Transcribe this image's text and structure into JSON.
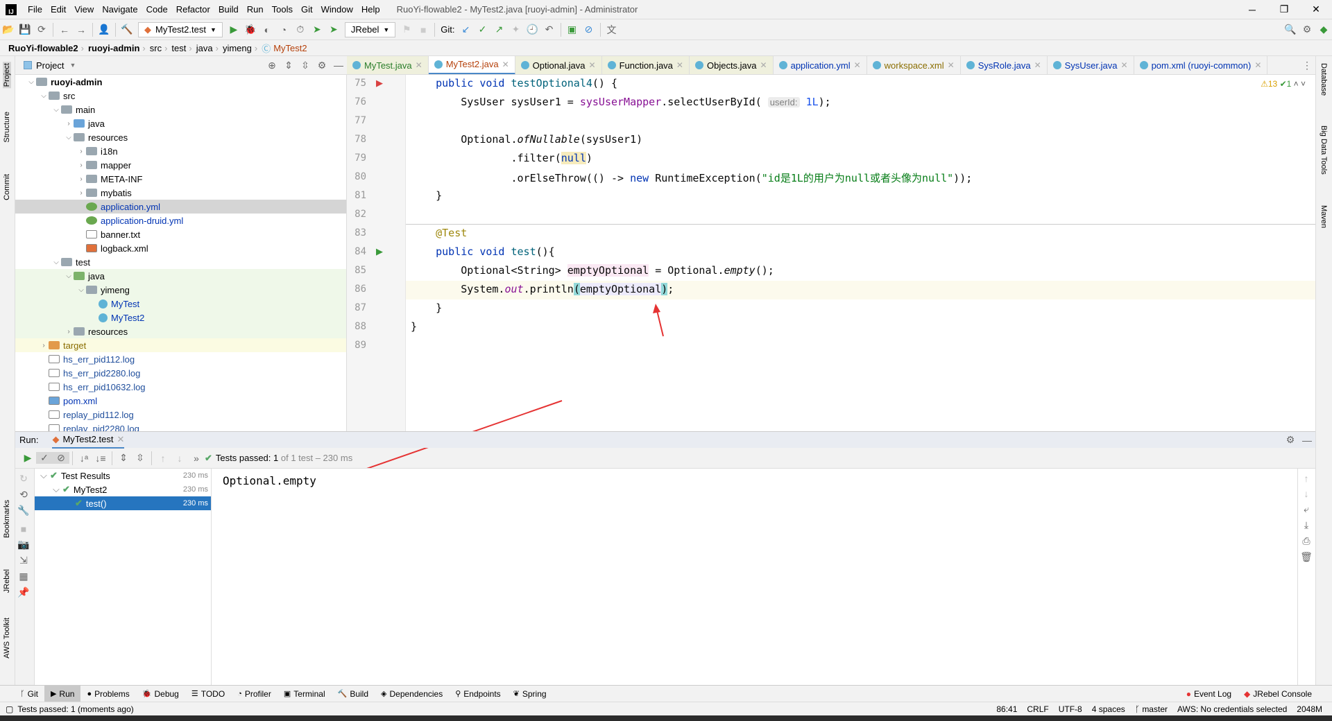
{
  "app": {
    "logo": "IJ",
    "menu": [
      "File",
      "Edit",
      "View",
      "Navigate",
      "Code",
      "Refactor",
      "Build",
      "Run",
      "Tools",
      "Git",
      "Window",
      "Help"
    ],
    "title": "RuoYi-flowable2 - MyTest2.java [ruoyi-admin] - Administrator",
    "window_controls": [
      "─",
      "❐",
      "✕"
    ]
  },
  "toolbar": {
    "run_config": "MyTest2.test",
    "jrebel": "JRebel",
    "git_label": "Git:"
  },
  "breadcrumb": [
    "RuoYi-flowable2",
    "ruoyi-admin",
    "src",
    "test",
    "java",
    "yimeng",
    "MyTest2"
  ],
  "left_stripe": [
    "Project",
    "Structure",
    "Commit",
    "Bookmarks",
    "JRebel",
    "AWS Toolkit"
  ],
  "right_stripe": [
    "Database",
    "Big Data Tools",
    "Maven"
  ],
  "project": {
    "title": "Project",
    "tree": [
      {
        "label": "ruoyi-admin",
        "level": 0,
        "arrow": "v",
        "icon": "folder",
        "bold": true
      },
      {
        "label": "src",
        "level": 1,
        "arrow": "v",
        "icon": "folder"
      },
      {
        "label": "main",
        "level": 2,
        "arrow": "v",
        "icon": "folder"
      },
      {
        "label": "java",
        "level": 3,
        "arrow": ">",
        "icon": "folder-blue"
      },
      {
        "label": "resources",
        "level": 3,
        "arrow": "v",
        "icon": "folder"
      },
      {
        "label": "i18n",
        "level": 4,
        "arrow": ">",
        "icon": "folder"
      },
      {
        "label": "mapper",
        "level": 4,
        "arrow": ">",
        "icon": "folder"
      },
      {
        "label": "META-INF",
        "level": 4,
        "arrow": ">",
        "icon": "folder"
      },
      {
        "label": "mybatis",
        "level": 4,
        "arrow": ">",
        "icon": "folder"
      },
      {
        "label": "application.yml",
        "level": 4,
        "icon": "yml",
        "color": "#0033b3",
        "selected": true
      },
      {
        "label": "application-druid.yml",
        "level": 4,
        "icon": "yml",
        "color": "#0033b3"
      },
      {
        "label": "banner.txt",
        "level": 4,
        "icon": "file"
      },
      {
        "label": "logback.xml",
        "level": 4,
        "icon": "xml"
      },
      {
        "label": "test",
        "level": 2,
        "arrow": "v",
        "icon": "folder"
      },
      {
        "label": "java",
        "level": 3,
        "arrow": "v",
        "icon": "folder-green",
        "green": true
      },
      {
        "label": "yimeng",
        "level": 4,
        "arrow": "v",
        "icon": "folder",
        "green": true
      },
      {
        "label": "MyTest",
        "level": 5,
        "icon": "java",
        "color": "#0033b3",
        "green": true
      },
      {
        "label": "MyTest2",
        "level": 5,
        "icon": "java",
        "color": "#0033b3",
        "green": true
      },
      {
        "label": "resources",
        "level": 3,
        "arrow": ">",
        "icon": "folder",
        "green": true
      },
      {
        "label": "target",
        "level": 1,
        "arrow": ">",
        "icon": "folder-orange",
        "yellow": true,
        "color": "#8a6d00"
      },
      {
        "label": "hs_err_pid112.log",
        "level": 1,
        "icon": "file",
        "color": "#1f4e9c"
      },
      {
        "label": "hs_err_pid2280.log",
        "level": 1,
        "icon": "file",
        "color": "#1f4e9c"
      },
      {
        "label": "hs_err_pid10632.log",
        "level": 1,
        "icon": "file",
        "color": "#1f4e9c"
      },
      {
        "label": "pom.xml",
        "level": 1,
        "icon": "maven",
        "color": "#0033b3"
      },
      {
        "label": "replay_pid112.log",
        "level": 1,
        "icon": "file",
        "color": "#1f4e9c"
      },
      {
        "label": "replay_pid2280.log",
        "level": 1,
        "icon": "file",
        "color": "#1f4e9c"
      }
    ]
  },
  "tabs": [
    {
      "label": "MyTest.java",
      "color": "#2a7d2a"
    },
    {
      "label": "MyTest2.java",
      "color": "#b5400a",
      "active": true
    },
    {
      "label": "Optional.java",
      "color": "#000"
    },
    {
      "label": "Function.java",
      "color": "#000"
    },
    {
      "label": "Objects.java",
      "color": "#000"
    },
    {
      "label": "application.yml",
      "color": "#0033b3"
    },
    {
      "label": "workspace.xml",
      "color": "#8a6d00"
    },
    {
      "label": "SysRole.java",
      "color": "#0033b3"
    },
    {
      "label": "SysUser.java",
      "color": "#0033b3"
    },
    {
      "label": "pom.xml (ruoyi-common)",
      "color": "#0033b3"
    }
  ],
  "editor": {
    "warnings": "⚠13",
    "ok": "✔1",
    "lines": [
      {
        "n": "75",
        "html": "    <span class='kw'>public void</span> <span class='fn'>testOptional4</span>() {"
      },
      {
        "n": "76",
        "html": "        SysUser sysUser1 = <span class='fld'>sysUserMapper</span>.selectUserById( <span class='hint'>userId:</span> <span class='num'>1L</span>);"
      },
      {
        "n": "77",
        "html": ""
      },
      {
        "n": "78",
        "html": "        Optional.<span class='it'>ofNullable</span>(sysUser1)"
      },
      {
        "n": "79",
        "html": "                .filter(<span class='kw' style='background:#f6ebbc'>null</span>)"
      },
      {
        "n": "80",
        "html": "                .orElseThrow(() -> <span class='kw'>new</span> RuntimeException(<span class='str'>\"id是1L的用户为null或者头像为null\"</span>));"
      },
      {
        "n": "81",
        "html": "    }"
      },
      {
        "n": "82",
        "html": ""
      },
      {
        "n": "83",
        "html": "    <span class='ann'>@Test</span>"
      },
      {
        "n": "84",
        "html": "    <span class='kw'>public void</span> <span class='fn'>test</span>(){"
      },
      {
        "n": "85",
        "html": "        Optional&lt;String&gt; <span style='background:#fae8f3'>emptyOptional</span> = Optional.<span class='it'>empty</span>();"
      },
      {
        "n": "86",
        "html": "        System.<span class='fld it'>out</span>.println<span style='background:#93d9d9'>(</span><span style='background:#edebfc'>emptyOptional</span><span style='background:#93d9d9'>)</span>;"
      },
      {
        "n": "87",
        "html": "    }"
      },
      {
        "n": "88",
        "html": "}"
      },
      {
        "n": "89",
        "html": ""
      }
    ]
  },
  "run": {
    "label": "Run:",
    "tab": "MyTest2.test",
    "status_strong": "Tests passed: 1",
    "status_rest": "of 1 test – 230 ms",
    "results": [
      {
        "label": "Test Results",
        "time": "230 ms",
        "level": 0
      },
      {
        "label": "MyTest2",
        "time": "230 ms",
        "level": 1
      },
      {
        "label": "test()",
        "time": "230 ms",
        "level": 2,
        "selected": true
      }
    ],
    "console": "Optional.empty"
  },
  "bottom_tools": [
    "Git",
    "Run",
    "Problems",
    "Debug",
    "TODO",
    "Profiler",
    "Terminal",
    "Build",
    "Dependencies",
    "Endpoints",
    "Spring"
  ],
  "bottom_right": [
    "Event Log",
    "JRebel Console"
  ],
  "status": {
    "message": "Tests passed: 1 (moments ago)",
    "position": "86:41",
    "line_sep": "CRLF",
    "encoding": "UTF-8",
    "indent": "4 spaces",
    "branch": "master",
    "aws": "AWS: No credentials selected",
    "memory": "2048M"
  }
}
